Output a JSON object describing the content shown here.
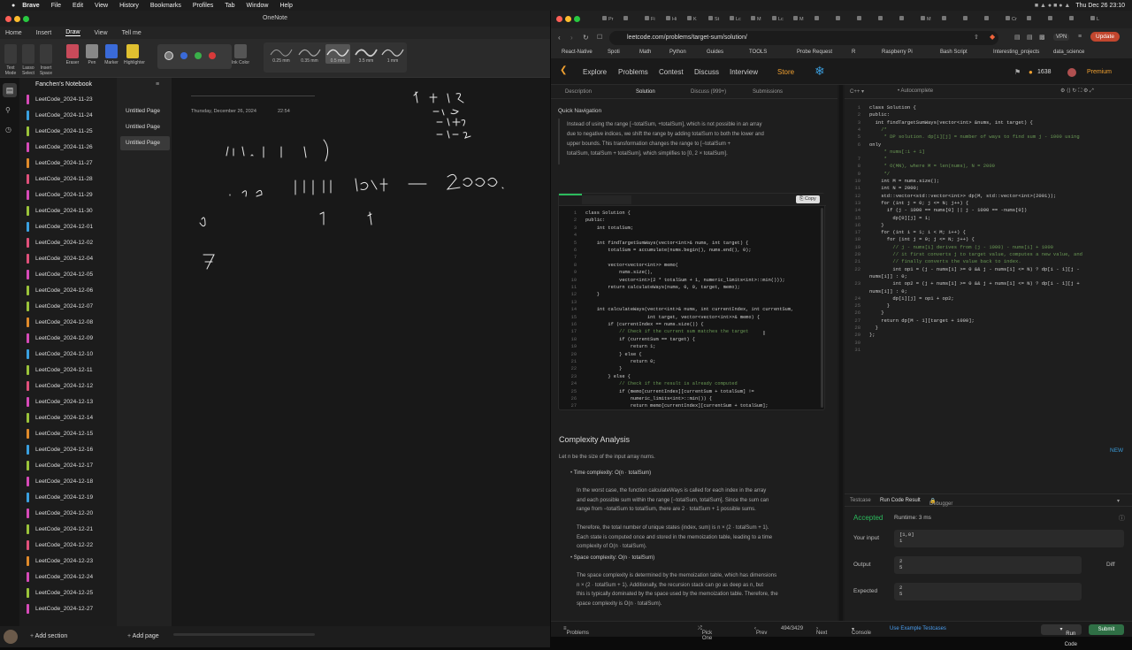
{
  "menubar": {
    "app": "Brave",
    "items": [
      "File",
      "Edit",
      "View",
      "History",
      "Bookmarks",
      "Profiles",
      "Tab",
      "Window",
      "Help"
    ],
    "datetime": "Thu Dec 26 23:10"
  },
  "onenote": {
    "window_title": "OneNote",
    "tabs": [
      "Home",
      "Insert",
      "Draw",
      "View",
      "Tell me"
    ],
    "active_tab": "Draw",
    "ribbon": {
      "tools": [
        "Text Mode",
        "Lasso Select",
        "Insert Space",
        "Eraser",
        "Pen",
        "Marker",
        "Highlighter",
        "Ink Color"
      ],
      "pens": [
        "0.25 mm",
        "0.35 mm",
        "0.5 mm",
        "3.5 mm",
        "1 mm"
      ]
    },
    "notebook": "Fanchen's Notebook",
    "sections": [
      {
        "label": "LeetCode_2024-11-23",
        "color": "#d64ab8"
      },
      {
        "label": "LeetCode_2024-11-24",
        "color": "#3aa0e0"
      },
      {
        "label": "LeetCode_2024-11-25",
        "color": "#9ac33a"
      },
      {
        "label": "LeetCode_2024-11-26",
        "color": "#d64ab8"
      },
      {
        "label": "LeetCode_2024-11-27",
        "color": "#e08a2a"
      },
      {
        "label": "LeetCode_2024-11-28",
        "color": "#e0507a"
      },
      {
        "label": "LeetCode_2024-11-29",
        "color": "#d64ab8"
      },
      {
        "label": "LeetCode_2024-11-30",
        "color": "#9ac33a"
      },
      {
        "label": "LeetCode_2024-12-01",
        "color": "#3aa0e0"
      },
      {
        "label": "LeetCode_2024-12-02",
        "color": "#e0507a"
      },
      {
        "label": "LeetCode_2024-12-04",
        "color": "#e0507a"
      },
      {
        "label": "LeetCode_2024-12-05",
        "color": "#d64ab8"
      },
      {
        "label": "LeetCode_2024-12-06",
        "color": "#9ac33a"
      },
      {
        "label": "LeetCode_2024-12-07",
        "color": "#9ac33a"
      },
      {
        "label": "LeetCode_2024-12-08",
        "color": "#e08a2a"
      },
      {
        "label": "LeetCode_2024-12-09",
        "color": "#d64ab8"
      },
      {
        "label": "LeetCode_2024-12-10",
        "color": "#3aa0e0"
      },
      {
        "label": "LeetCode_2024-12-11",
        "color": "#9ac33a"
      },
      {
        "label": "LeetCode_2024-12-12",
        "color": "#e0507a"
      },
      {
        "label": "LeetCode_2024-12-13",
        "color": "#d64ab8"
      },
      {
        "label": "LeetCode_2024-12-14",
        "color": "#9ac33a"
      },
      {
        "label": "LeetCode_2024-12-15",
        "color": "#e08a2a"
      },
      {
        "label": "LeetCode_2024-12-16",
        "color": "#3aa0e0"
      },
      {
        "label": "LeetCode_2024-12-17",
        "color": "#9ac33a"
      },
      {
        "label": "LeetCode_2024-12-18",
        "color": "#d64ab8"
      },
      {
        "label": "LeetCode_2024-12-19",
        "color": "#3aa0e0"
      },
      {
        "label": "LeetCode_2024-12-20",
        "color": "#d64ab8"
      },
      {
        "label": "LeetCode_2024-12-21",
        "color": "#9ac33a"
      },
      {
        "label": "LeetCode_2024-12-22",
        "color": "#e0507a"
      },
      {
        "label": "LeetCode_2024-12-23",
        "color": "#e08a2a"
      },
      {
        "label": "LeetCode_2024-12-24",
        "color": "#d64ab8"
      },
      {
        "label": "LeetCode_2024-12-25",
        "color": "#9ac33a"
      },
      {
        "label": "LeetCode_2024-12-27",
        "color": "#d64ab8"
      }
    ],
    "pages": [
      "Untitled Page",
      "Untitled Page",
      "Untitled Page"
    ],
    "page_date": "Thursday, December 26, 2024",
    "page_time": "22:54",
    "add_section": "Add section",
    "add_page": "Add page"
  },
  "browser": {
    "url": "leetcode.com/problems/target-sum/solution/",
    "tabs": [
      "Pr",
      "",
      "Fi",
      "Hi",
      "K",
      "St",
      "Lc",
      "M",
      "Lc",
      "M",
      "",
      "",
      "",
      "",
      "",
      "M",
      "",
      "",
      "",
      "Cr",
      "",
      "",
      "",
      "L"
    ],
    "vpn": "VPN",
    "update": "Update",
    "bookmarks": [
      "React-Native",
      "Spoti",
      "Math",
      "Python",
      "Guides",
      "TOOLS",
      "Probe Request",
      "R",
      "Raspberry Pi",
      "Bash Script",
      "Interesting_projects",
      "data_science"
    ]
  },
  "leetcode": {
    "nav": [
      "Explore",
      "Problems",
      "Contest",
      "Discuss",
      "Interview",
      "Store"
    ],
    "coins": "1638",
    "premium": "Premium",
    "left_tabs": [
      "Description",
      "Solution",
      "Discuss (999+)",
      "Submissions"
    ],
    "quick_nav": "Quick Navigation",
    "intro_lines": [
      "Instead of using the range [−totalSum, +totalSum], which is not possible in an array",
      "due to negative indices, we shift the range by adding totalSum to both the lower and",
      "upper bounds. This transformation changes the range to [−totalSum +",
      "totalSum, totalSum + totalSum], which simplifies to [0, 2 × totalSum]."
    ],
    "copy": "Copy",
    "code_lines": [
      "class Solution {",
      "public:",
      "    int totalSum;",
      "",
      "    int findTargetSumWays(vector<int>& nums, int target) {",
      "        totalSum = accumulate(nums.begin(), nums.end(), 0);",
      "",
      "        vector<vector<int>> memo(",
      "            nums.size(),",
      "            vector<int>(2 * totalSum + 1, numeric_limits<int>::min()));",
      "        return calculateWays(nums, 0, 0, target, memo);",
      "    }",
      "",
      "    int calculateWays(vector<int>& nums, int currentIndex, int currentSum,",
      "                      int target, vector<vector<int>>& memo) {",
      "        if (currentIndex == nums.size()) {",
      "            // Check if the current sum matches the target",
      "            if (currentSum == target) {",
      "                return 1;",
      "            } else {",
      "                return 0;",
      "            }",
      "        } else {",
      "            // Check if the result is already computed",
      "            if (memo[currentIndex][currentSum + totalSum] !=",
      "                numeric_limits<int>::min()) {",
      "                return memo[currentIndex][currentSum + totalSum];"
    ],
    "complexity_title": "Complexity Analysis",
    "complexity_intro": "Let n be the size of the input array nums.",
    "time_label": "Time complexity: O(n · totalSum)",
    "time_lines": [
      "In the worst case, the function calculateWays is called for each index in the array",
      "and each possible sum within the range [−totalSum, totalSum]. Since the sum can",
      "range from −totalSum to totalSum, there are 2 · totalSum + 1 possible sums.",
      "",
      "Therefore, the total number of unique states (index, sum) is n × (2 · totalSum + 1).",
      "Each state is computed once and stored in the memoization table, leading to a time",
      "complexity of O(n · totalSum)."
    ],
    "space_label": "Space complexity: O(n · totalSum)",
    "space_lines": [
      "The space complexity is determined by the memoization table, which has dimensions",
      "n × (2 · totalSum + 1). Additionally, the recursion stack can go as deep as n, but",
      "this is typically dominated by the space used by the memoization table. Therefore, the",
      "space complexity is O(n · totalSum)."
    ],
    "lang": "C++",
    "autocomplete": "Autocomplete",
    "editor_lines": [
      "class Solution {",
      "public:",
      "  int findTargetSumWays(vector<int> &nums, int target) {",
      "    /*",
      "     * DP solution. dp[i][j] = number of ways to find sum j - 1000 using",
      "only",
      "     * nums[:i + 1]",
      "     *",
      "     * O(MN), where M = len(nums), N = 2000",
      "     */",
      "    int M = nums.size();",
      "    int N = 2000;",
      "    std::vector<std::vector<int>> dp(M, std::vector<int>(2001));",
      "    for (int j = 0; j <= N; j++) {",
      "      if (j - 1000 == nums[0] || j - 1000 == -nums[0])",
      "        dp[0][j] = 1;",
      "    }",
      "    for (int i = 1; i < M; i++) {",
      "      for (int j = 0; j <= N; j++) {",
      "        // j - nums[i] derives from (j - 1000) - nums[i] + 1000",
      "        // it first converts j to target value, computes a new value, and",
      "        // finally converts the value back to index.",
      "        int op1 = (j - nums[i] >= 0 && j - nums[i] <= N) ? dp[i - 1][j -",
      "nums[i]] : 0;",
      "        int op2 = (j + nums[i] >= 0 && j + nums[i] <= N) ? dp[i - 1][j +",
      "nums[i]] : 0;",
      "        dp[i][j] = op1 + op2;",
      "      }",
      "    }",
      "    return dp[M - 1][target + 1000];",
      "  }",
      "};",
      "",
      ""
    ],
    "editor_numbers": [
      "1",
      "2",
      "3",
      "4",
      "5",
      "6",
      "",
      "7",
      "8",
      "9",
      "10",
      "11",
      "12",
      "13",
      "14",
      "15",
      "16",
      "17",
      "18",
      "19",
      "20",
      "21",
      "22",
      "",
      "23",
      "",
      "24",
      "25",
      "26",
      "27",
      "28",
      "29",
      "30",
      "31"
    ],
    "new_badge": "NEW",
    "result_tabs": [
      "Testcase",
      "Run Code Result",
      "Debugger"
    ],
    "accepted": "Accepted",
    "runtime": "Runtime: 3 ms",
    "your_input_label": "Your input",
    "your_input": [
      "[1,0]",
      "1"
    ],
    "output_label": "Output",
    "output": [
      "2",
      "5"
    ],
    "expected_label": "Expected",
    "expected": [
      "2",
      "5"
    ],
    "diff": "Diff",
    "footer": {
      "problems": "Problems",
      "pick_one": "Pick One",
      "prev": "Prev",
      "count": "494/3429",
      "next": "Next",
      "console": "Console",
      "use_example": "Use Example Testcases",
      "run_code": "Run Code",
      "submit": "Submit"
    }
  }
}
